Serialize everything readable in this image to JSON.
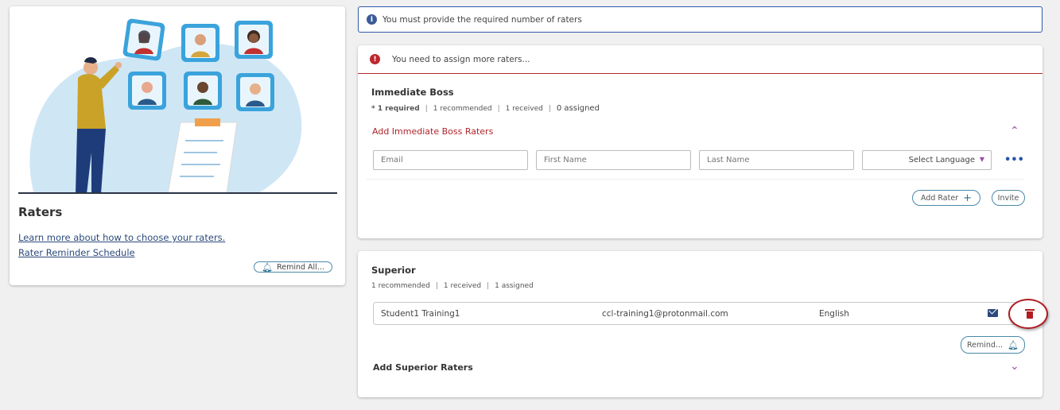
{
  "left_panel": {
    "title": "Raters",
    "learn_link": "Learn more about how to choose your raters.",
    "schedule_link": "Rater Reminder Schedule",
    "remind_all_label": "Remind All..."
  },
  "info_banner": {
    "icon": "info-icon",
    "text": "You must provide the required number of raters"
  },
  "immediate_boss": {
    "warning_icon": "alert-icon",
    "warning_text": "You need to assign more raters...",
    "title": "Immediate Boss",
    "meta": {
      "required": "* 1 required",
      "recommended": "1 recommended",
      "received": "1 received",
      "assigned": "0 assigned"
    },
    "add_link": "Add Immediate Boss Raters",
    "form": {
      "email_placeholder": "Email",
      "first_name_placeholder": "First Name",
      "last_name_placeholder": "Last Name",
      "language_value": "Select Language",
      "more_label": "•••"
    },
    "add_rater_label": "Add Rater",
    "invite_label": "Invite"
  },
  "superior": {
    "title": "Superior",
    "meta": {
      "recommended": "1 recommended",
      "received": "1 received",
      "assigned": "1 assigned"
    },
    "rater": {
      "name": "Student1 Training1",
      "email": "ccl-training1@protonmail.com",
      "language": "English"
    },
    "remind_label": "Remind...",
    "add_link": "Add Superior Raters"
  },
  "colors": {
    "accent_red": "#b0242b",
    "accent_blue": "#2f5aa8",
    "chevron_purple": "#9b4fa3"
  }
}
